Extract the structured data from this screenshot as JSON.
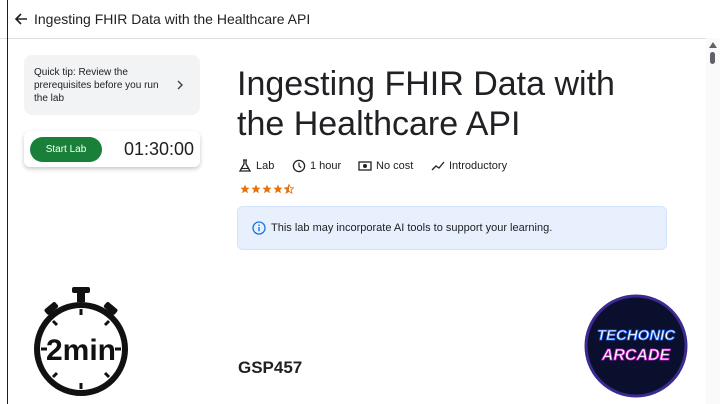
{
  "header": {
    "title": "Ingesting FHIR Data with the Healthcare API",
    "back_icon": "arrow-back-icon"
  },
  "tip": {
    "text": "Quick tip: Review the prerequisites before you run the lab",
    "icon": "chevron-right-icon"
  },
  "lab_control": {
    "start_label": "Start Lab",
    "timer": "01:30:00",
    "button_color": "#188038"
  },
  "main": {
    "title": "Ingesting FHIR Data with the Healthcare API",
    "meta": [
      {
        "icon": "flask-icon",
        "label": "Lab"
      },
      {
        "icon": "clock-icon",
        "label": "1 hour"
      },
      {
        "icon": "money-icon",
        "label": "No cost"
      },
      {
        "icon": "trending-icon",
        "label": "Introductory"
      }
    ],
    "rating": {
      "value": 4.5,
      "max": 5,
      "color": "#e8710a"
    },
    "ai_notice": {
      "icon": "info-icon",
      "text": "This lab may incorporate AI tools to support your learning."
    },
    "lab_code": "GSP457"
  },
  "overlays": {
    "stopwatch": {
      "label": "2min"
    },
    "channel_logo": {
      "line1": "TECHONIC",
      "line2": "ARCADE"
    }
  },
  "colors": {
    "accent_blue": "#1a73e8",
    "banner_bg": "#e8f0fe"
  }
}
